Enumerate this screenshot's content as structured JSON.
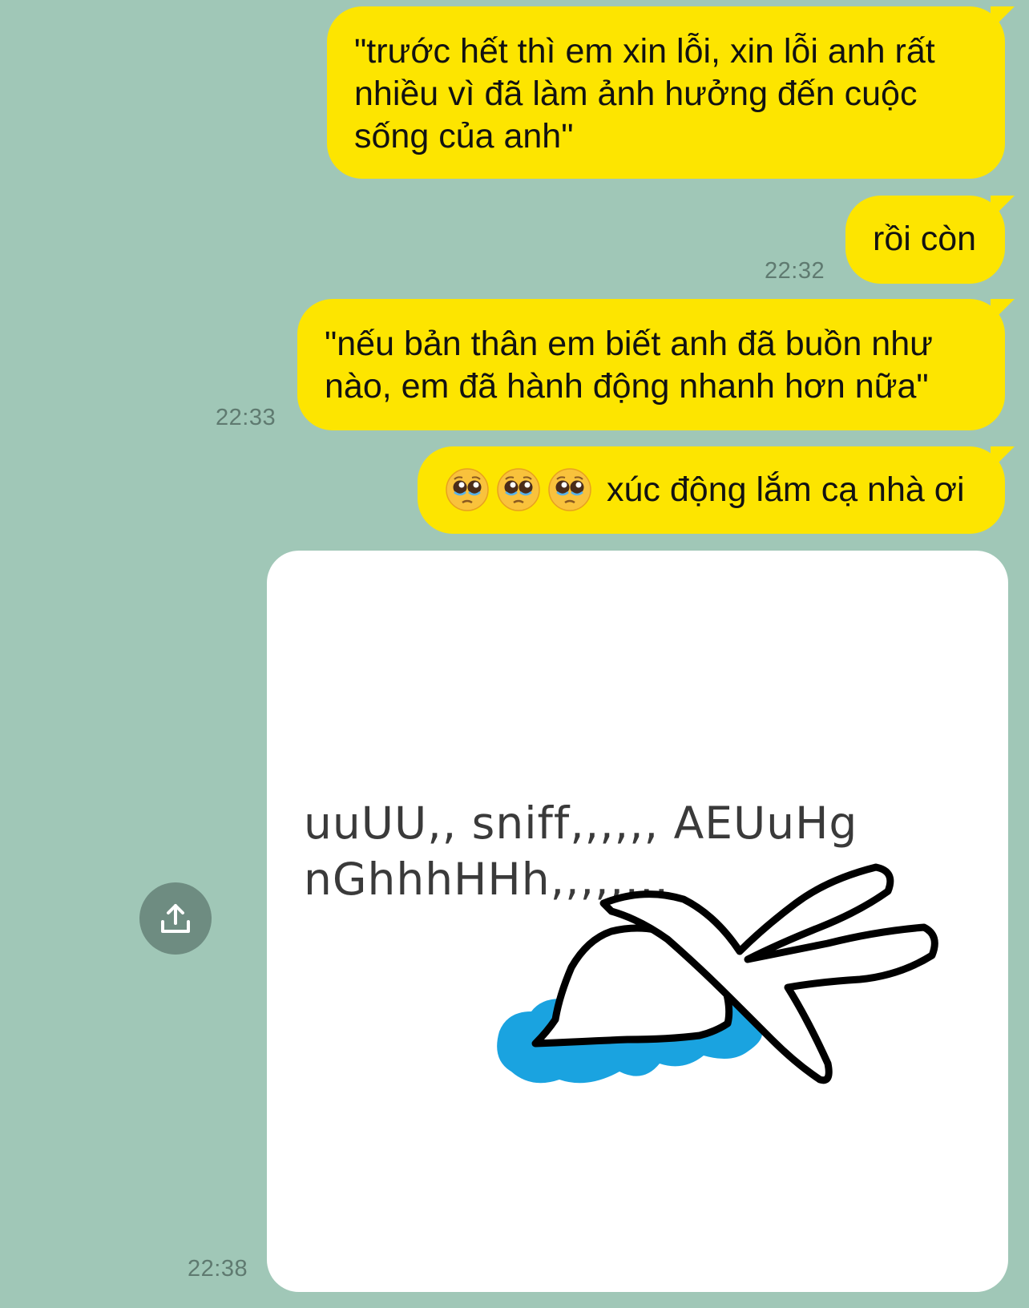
{
  "messages": [
    {
      "id": "msg1",
      "text": "\"trước hết thì em xin lỗi, xin lỗi anh rất nhiều vì đã làm ảnh hưởng đến cuộc sống của anh\""
    },
    {
      "id": "msg2",
      "text": "rồi còn",
      "time": "22:32"
    },
    {
      "id": "msg3",
      "text": "\"nếu bản thân em biết anh đã buồn như nào, em đã hành động nhanh hơn nữa\"",
      "time": "22:33"
    },
    {
      "id": "msg4",
      "emojis": [
        "pleading-face",
        "pleading-face",
        "pleading-face"
      ],
      "text": "xúc động lắm cạ nhà ơi"
    }
  ],
  "sticker": {
    "line1": "uuUU,, sniff,,,,,, AEUuHg",
    "line2": "nGhhhHHh,,,,,,,,",
    "time": "22:38"
  },
  "share_button": {
    "icon": "share-upload-icon"
  },
  "colors": {
    "background": "#a0c7b7",
    "bubble": "#fde500",
    "timestamp": "#5f7a70",
    "share_button": "#6e8c81",
    "puddle": "#1aa3e0"
  }
}
